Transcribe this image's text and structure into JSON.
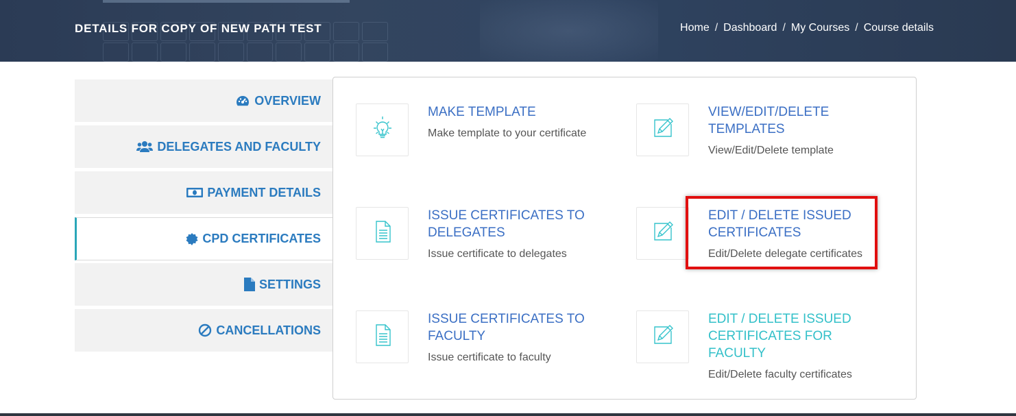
{
  "header": {
    "title": "DETAILS FOR COPY OF NEW PATH TEST",
    "breadcrumb": [
      "Home",
      "Dashboard",
      "My Courses",
      "Course details"
    ],
    "separator": "/"
  },
  "sidebar": {
    "items": [
      {
        "label": "OVERVIEW",
        "icon": "dashboard-gauge-icon",
        "active": false
      },
      {
        "label": "DELEGATES AND FACULTY",
        "icon": "users-icon",
        "active": false
      },
      {
        "label": "PAYMENT DETAILS",
        "icon": "money-bill-icon",
        "active": false
      },
      {
        "label": "CPD CERTIFICATES",
        "icon": "certificate-badge-icon",
        "active": true
      },
      {
        "label": "SETTINGS",
        "icon": "file-icon",
        "active": false
      },
      {
        "label": "CANCELLATIONS",
        "icon": "ban-icon",
        "active": false
      }
    ]
  },
  "tiles": [
    {
      "title": "MAKE TEMPLATE",
      "desc": "Make template to your certificate",
      "icon": "lightbulb-icon"
    },
    {
      "title": "VIEW/EDIT/DELETE TEMPLATES",
      "desc": "View/Edit/Delete template",
      "icon": "edit-pencil-icon"
    },
    {
      "title": "ISSUE CERTIFICATES TO DELEGATES",
      "desc": "Issue certificate to delegates",
      "icon": "document-icon"
    },
    {
      "title": "EDIT / DELETE ISSUED CERTIFICATES",
      "desc": "Edit/Delete delegate certificates",
      "icon": "edit-pencil-icon",
      "highlighted": true
    },
    {
      "title": "ISSUE CERTIFICATES TO FACULTY",
      "desc": "Issue certificate to faculty",
      "icon": "document-icon"
    },
    {
      "title": "EDIT / DELETE ISSUED CERTIFICATES FOR FACULTY",
      "desc": "Edit/Delete faculty certificates",
      "icon": "edit-pencil-icon"
    }
  ],
  "colors": {
    "accent_blue": "#2b7bbf",
    "tile_title_blue": "#3b6fc4",
    "teal": "#33c0c9",
    "highlight_red": "#e10f0f",
    "header_bg": "#2f4360"
  }
}
